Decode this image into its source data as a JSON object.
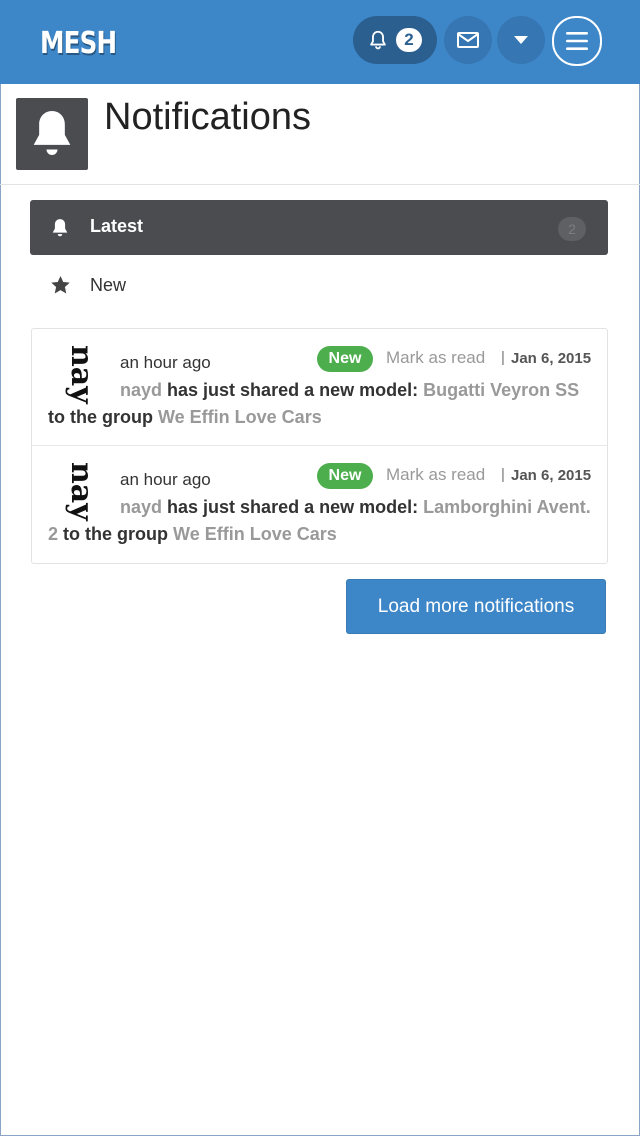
{
  "app": {
    "logo": "MESH",
    "accent": "#3d86c8",
    "dark": "#4a4c50",
    "success": "#4cae4c"
  },
  "topbar": {
    "notifications_count": "2",
    "icons": [
      "bell-icon",
      "envelope-icon",
      "caret-down-icon",
      "hamburger-menu-icon"
    ]
  },
  "header": {
    "title": "Notifications"
  },
  "tabs": [
    {
      "label": "Latest",
      "count": "2",
      "icon": "bell-icon",
      "active": true
    },
    {
      "label": "New",
      "icon": "star-icon",
      "active": false
    }
  ],
  "notifications": [
    {
      "avatar_text": "nay",
      "time": "an hour ago",
      "badge": "New",
      "mark_as_read": "Mark as read",
      "separator": "|",
      "date": "Jan 6, 2015",
      "user": "nayd",
      "text1": "has just shared a new model:",
      "model": "Bugatti Veyron SS",
      "text2": "to the group",
      "group": "We Effin Love Cars"
    },
    {
      "avatar_text": "nay",
      "time": "an hour ago",
      "badge": "New",
      "mark_as_read": "Mark as read",
      "separator": "|",
      "date": "Jan 6, 2015",
      "user": "nayd",
      "text1": "has just shared a new model:",
      "model": "Lamborghini Avent. 2",
      "text2": "to the group",
      "group": "We Effin Love Cars"
    }
  ],
  "load_more": "Load more notifications"
}
